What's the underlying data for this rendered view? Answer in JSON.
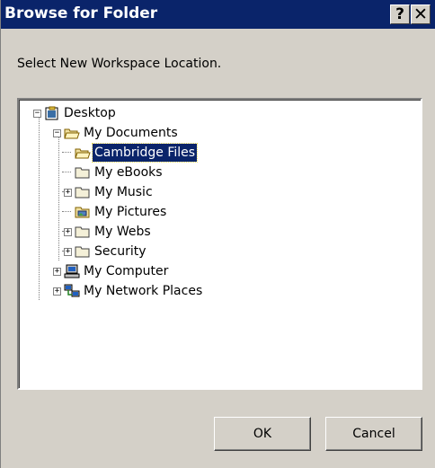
{
  "window": {
    "title": "Browse for Folder",
    "help_glyph": "?",
    "close_glyph": "✕"
  },
  "prompt": "Select New Workspace Location.",
  "tree": {
    "desktop": "Desktop",
    "my_documents": "My Documents",
    "cambridge_files": "Cambridge Files",
    "my_ebooks": "My eBooks",
    "my_music": "My Music",
    "my_pictures": "My Pictures",
    "my_webs": "My Webs",
    "security": "Security",
    "my_computer": "My Computer",
    "my_network_places": "My Network Places",
    "selected": "Cambridge Files"
  },
  "buttons": {
    "ok": "OK",
    "cancel": "Cancel"
  },
  "colors": {
    "titlebar": "#0a246a",
    "dialog_face": "#d4d0c8",
    "selection": "#0a246a"
  }
}
